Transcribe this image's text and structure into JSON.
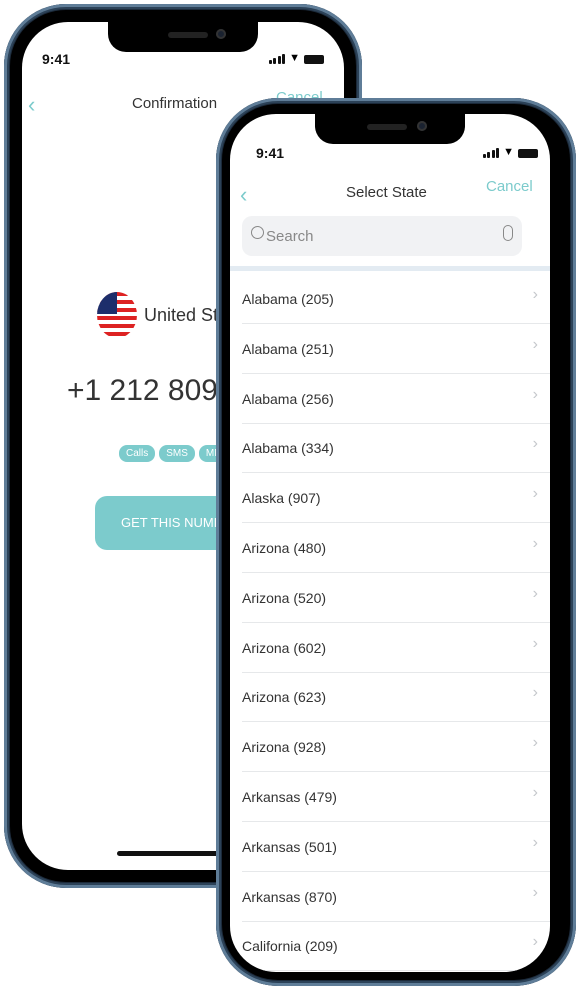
{
  "status_time": "9:41",
  "confirmation": {
    "title": "Confirmation",
    "cancel": "Cancel",
    "country": "United States",
    "number": "+1 212 809 2",
    "capabilities": [
      "Calls",
      "SMS",
      "MMS"
    ],
    "cta": "GET THIS NUMBER",
    "accent": "#7ccbcc"
  },
  "select_state": {
    "title": "Select State",
    "cancel": "Cancel",
    "search_placeholder": "Search",
    "states": [
      "Alabama (205)",
      "Alabama (251)",
      "Alabama (256)",
      "Alabama (334)",
      "Alaska (907)",
      "Arizona (480)",
      "Arizona (520)",
      "Arizona (602)",
      "Arizona (623)",
      "Arizona (928)",
      "Arkansas (479)",
      "Arkansas (501)",
      "Arkansas (870)",
      "California (209)"
    ]
  }
}
